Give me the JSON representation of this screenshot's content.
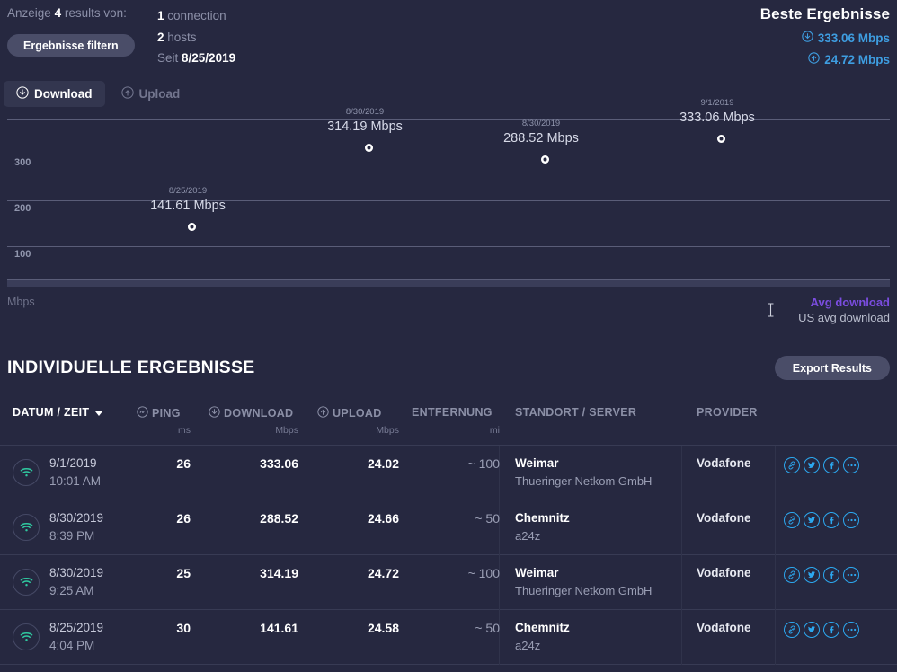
{
  "summary": {
    "showing_prefix": "Anzeige",
    "showing_count": "4",
    "showing_suffix": "results von:",
    "filter_button": "Ergebnisse filtern",
    "connections_count": "1",
    "connections_label": "connection",
    "hosts_count": "2",
    "hosts_label": "hosts",
    "since_label": "Seit",
    "since_date": "8/25/2019"
  },
  "best_results": {
    "title": "Beste Ergebnisse",
    "download": "333.06 Mbps",
    "upload": "24.72 Mbps",
    "download_icon": "download-circle-icon",
    "upload_icon": "upload-circle-icon",
    "accent_color": "#3e9de0"
  },
  "tabs": [
    {
      "label": "Download",
      "icon": "download-circle-icon",
      "active": true
    },
    {
      "label": "Upload",
      "icon": "upload-circle-icon",
      "active": false
    }
  ],
  "chart_data": {
    "type": "scatter",
    "title": "",
    "xlabel": "",
    "ylabel": "Mbps",
    "ylim": [
      0,
      400
    ],
    "yticks": [
      100,
      200,
      300
    ],
    "grid": true,
    "legend_position": "bottom-right",
    "legend": [
      {
        "label": "Avg download",
        "color": "#7b4de0"
      },
      {
        "label": "US avg download",
        "color": "#b9bdcd"
      }
    ],
    "points": [
      {
        "date": "8/25/2019",
        "label": "141.61 Mbps",
        "value": 141.61
      },
      {
        "date": "8/30/2019",
        "label": "314.19 Mbps",
        "value": 314.19
      },
      {
        "date": "8/30/2019",
        "label": "288.52 Mbps",
        "value": 288.52
      },
      {
        "date": "9/1/2019",
        "label": "333.06 Mbps",
        "value": 333.06
      }
    ]
  },
  "results_section": {
    "title": "INDIVIDUELLE ERGEBNISSE",
    "export_button": "Export Results"
  },
  "table": {
    "columns": [
      {
        "label": "DATUM / ZEIT",
        "unit": "",
        "icon": "",
        "sorted": true
      },
      {
        "label": "PING",
        "unit": "ms",
        "icon": "ping-icon",
        "sorted": false
      },
      {
        "label": "DOWNLOAD",
        "unit": "Mbps",
        "icon": "download-circle-icon",
        "sorted": false
      },
      {
        "label": "UPLOAD",
        "unit": "Mbps",
        "icon": "upload-circle-icon",
        "sorted": false
      },
      {
        "label": "ENTFERNUNG",
        "unit": "mi",
        "icon": "",
        "sorted": false
      },
      {
        "label": "STANDORT / SERVER",
        "unit": "",
        "icon": "",
        "sorted": false
      },
      {
        "label": "PROVIDER",
        "unit": "",
        "icon": "",
        "sorted": false
      }
    ],
    "rows": [
      {
        "connection_icon": "wifi-icon",
        "date": "9/1/2019",
        "time": "10:01 AM",
        "ping": "26",
        "download": "333.06",
        "upload": "24.02",
        "distance": "~ 100",
        "location": "Weimar",
        "server": "Thueringer Netkom GmbH",
        "provider": "Vodafone",
        "actions": [
          "link-icon",
          "twitter-icon",
          "facebook-icon",
          "more-icon"
        ]
      },
      {
        "connection_icon": "wifi-icon",
        "date": "8/30/2019",
        "time": "8:39 PM",
        "ping": "26",
        "download": "288.52",
        "upload": "24.66",
        "distance": "~ 50",
        "location": "Chemnitz",
        "server": "a24z",
        "provider": "Vodafone",
        "actions": [
          "link-icon",
          "twitter-icon",
          "facebook-icon",
          "more-icon"
        ]
      },
      {
        "connection_icon": "wifi-icon",
        "date": "8/30/2019",
        "time": "9:25 AM",
        "ping": "25",
        "download": "314.19",
        "upload": "24.72",
        "distance": "~ 100",
        "location": "Weimar",
        "server": "Thueringer Netkom GmbH",
        "provider": "Vodafone",
        "actions": [
          "link-icon",
          "twitter-icon",
          "facebook-icon",
          "more-icon"
        ]
      },
      {
        "connection_icon": "wifi-icon",
        "date": "8/25/2019",
        "time": "4:04 PM",
        "ping": "30",
        "download": "141.61",
        "upload": "24.58",
        "distance": "~ 50",
        "location": "Chemnitz",
        "server": "a24z",
        "provider": "Vodafone",
        "actions": [
          "link-icon",
          "twitter-icon",
          "facebook-icon",
          "more-icon"
        ]
      }
    ]
  }
}
